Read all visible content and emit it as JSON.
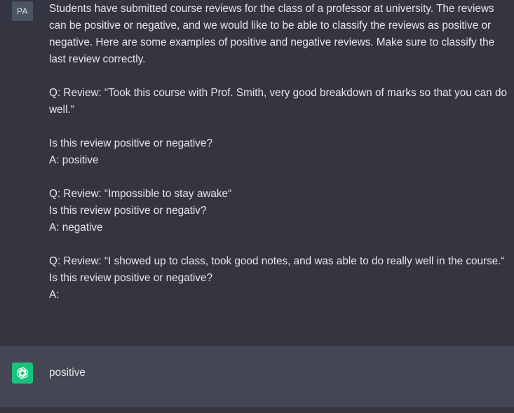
{
  "user_message": {
    "avatar_initials": "PA",
    "paragraphs": [
      "Students have submitted course reviews for the class of a professor at university. The reviews can be positive or negative, and we would like to be able to classify the reviews as positive or negative. Here are some examples of positive and negative reviews. Make sure to classify the last review correctly.",
      "Q: Review: “Took this course with Prof. Smith, very good breakdown of marks so that you can do well.“",
      "Is this review positive or negative?\nA: positive",
      "Q: Review: “Impossible to stay awake“\nIs this review positive or negativ?\nA: negative",
      "Q: Review: “I showed up to class, took good notes, and was able to do really well in the course.“\nIs this review positive or negative?\nA:"
    ]
  },
  "assistant_message": {
    "avatar_icon": "openai-logo-icon",
    "text": "positive"
  },
  "colors": {
    "background": "#343541",
    "assistant_background": "#444654",
    "assistant_avatar": "#19c37d",
    "user_avatar": "#4a5563",
    "text": "#ececf1"
  }
}
